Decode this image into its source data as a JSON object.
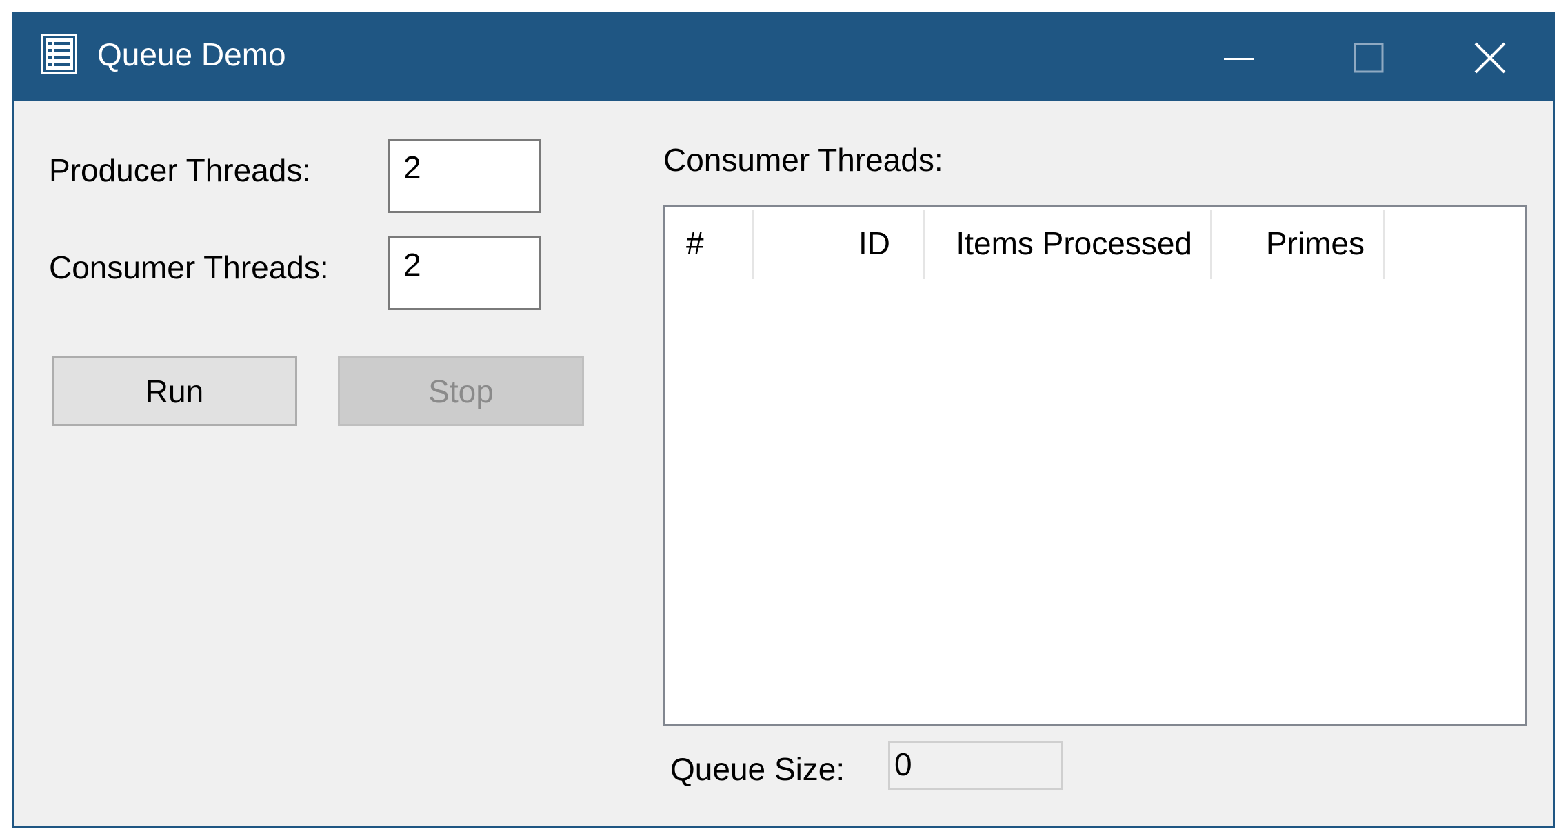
{
  "window": {
    "title": "Queue Demo",
    "icon": "list-app-icon",
    "controls": {
      "minimize": "minimize-icon",
      "maximize": "maximize-icon",
      "close": "close-icon"
    },
    "colors": {
      "titlebar": "#1f5683",
      "client": "#f0f0f0"
    }
  },
  "form": {
    "producer_label": "Producer Threads:",
    "producer_value": "2",
    "consumer_label": "Consumer Threads:",
    "consumer_value": "2",
    "run_label": "Run",
    "stop_label": "Stop"
  },
  "consumers": {
    "group_label": "Consumer Threads:",
    "columns": [
      "#",
      "ID",
      "Items Processed",
      "Primes"
    ],
    "rows": []
  },
  "queue": {
    "label": "Queue Size:",
    "value": "0"
  }
}
